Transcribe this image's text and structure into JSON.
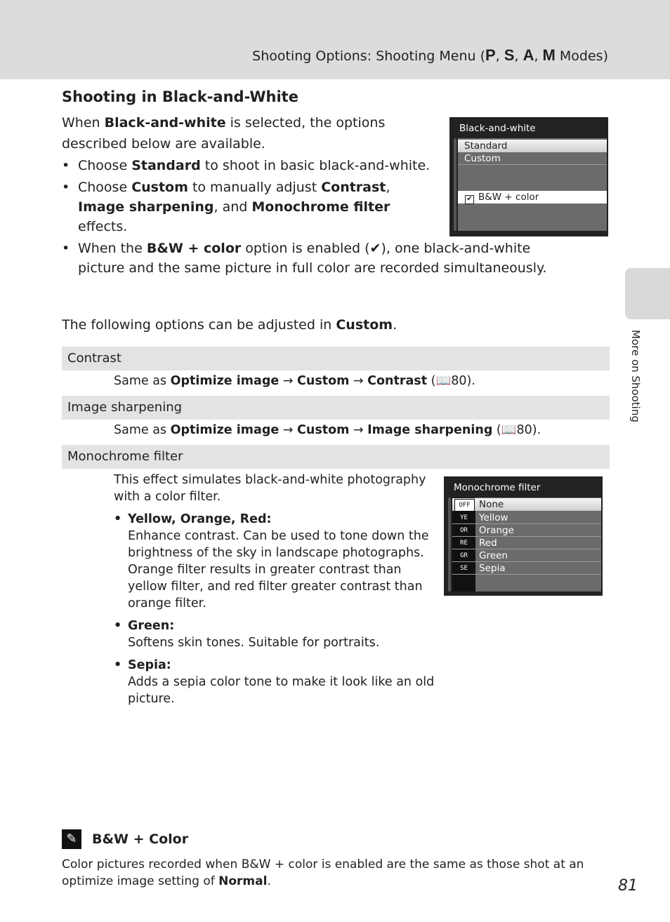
{
  "header": {
    "title_prefix": "Shooting Options: Shooting Menu (",
    "mode_p": "P",
    "mode_s": "S",
    "mode_a": "A",
    "mode_m": "M",
    "sep": ", ",
    "title_suffix": " Modes)"
  },
  "side_tab": {
    "label": "More on Shooting"
  },
  "section": {
    "title": "Shooting in Black-and-White",
    "intro_pre": "When ",
    "intro_bold": "Black-and-white",
    "intro_post": " is selected, the options described below are available.",
    "bullets": [
      {
        "pre": "Choose ",
        "b1": "Standard",
        "post": " to shoot in basic black-and-white."
      },
      {
        "pre": "Choose ",
        "b1": "Custom",
        "mid1": " to manually adjust ",
        "b2": "Contrast",
        "mid2": ", ",
        "b3": "Image sharpening",
        "mid3": ", and ",
        "b4": "Monochrome filter",
        "post": " effects."
      },
      {
        "pre": "When the ",
        "b1": "B&W + color",
        "mid1": " option is enabled (",
        "icon": "✔",
        "post": "), one black-and-white picture and the same picture in full color are recorded simultaneously."
      }
    ],
    "following_pre": "The following options can be adjusted in ",
    "following_bold": "Custom",
    "following_post": "."
  },
  "bw_screen": {
    "title": "Black-and-white",
    "items": [
      "Standard",
      "Custom"
    ],
    "selected": "Standard",
    "checkbox_label": "B&W + color",
    "checkbox_checked": true
  },
  "options": [
    {
      "label": "Contrast",
      "desc_pre": "Same as ",
      "path1": "Optimize image",
      "arrow": " → ",
      "path2": "Custom",
      "path3": "Contrast",
      "ref": " (📖80)."
    },
    {
      "label": "Image sharpening",
      "desc_pre": "Same as ",
      "path1": "Optimize image",
      "arrow": " → ",
      "path2": "Custom",
      "path3": "Image sharpening",
      "ref": " (📖80)."
    },
    {
      "label": "Monochrome filter"
    }
  ],
  "mono": {
    "intro": "This effect simulates black-and-white photography with a color filter.",
    "items": [
      {
        "title": "Yellow, Orange, Red:",
        "text": "Enhance contrast. Can be used to tone down the brightness of the sky in landscape photographs. Orange filter results in greater contrast than yellow filter, and red filter greater contrast than orange filter."
      },
      {
        "title": "Green:",
        "text": "Softens skin tones. Suitable for portraits."
      },
      {
        "title": "Sepia:",
        "text": "Adds a sepia color tone to make it look like an old picture."
      }
    ]
  },
  "mono_screen": {
    "title": "Monochrome filter",
    "items": [
      {
        "icon": "OFF",
        "label": "None"
      },
      {
        "icon": "YE",
        "label": "Yellow"
      },
      {
        "icon": "OR",
        "label": "Orange"
      },
      {
        "icon": "RE",
        "label": "Red"
      },
      {
        "icon": "GR",
        "label": "Green"
      },
      {
        "icon": "SE",
        "label": "Sepia"
      }
    ],
    "selected": "None"
  },
  "note": {
    "icon": "paperclip-icon",
    "title": "B&W + Color",
    "text_pre": "Color pictures recorded when B&W + color is enabled are the same as those shot at an optimize image setting of ",
    "text_bold": "Normal",
    "text_post": "."
  },
  "page_number": "81"
}
